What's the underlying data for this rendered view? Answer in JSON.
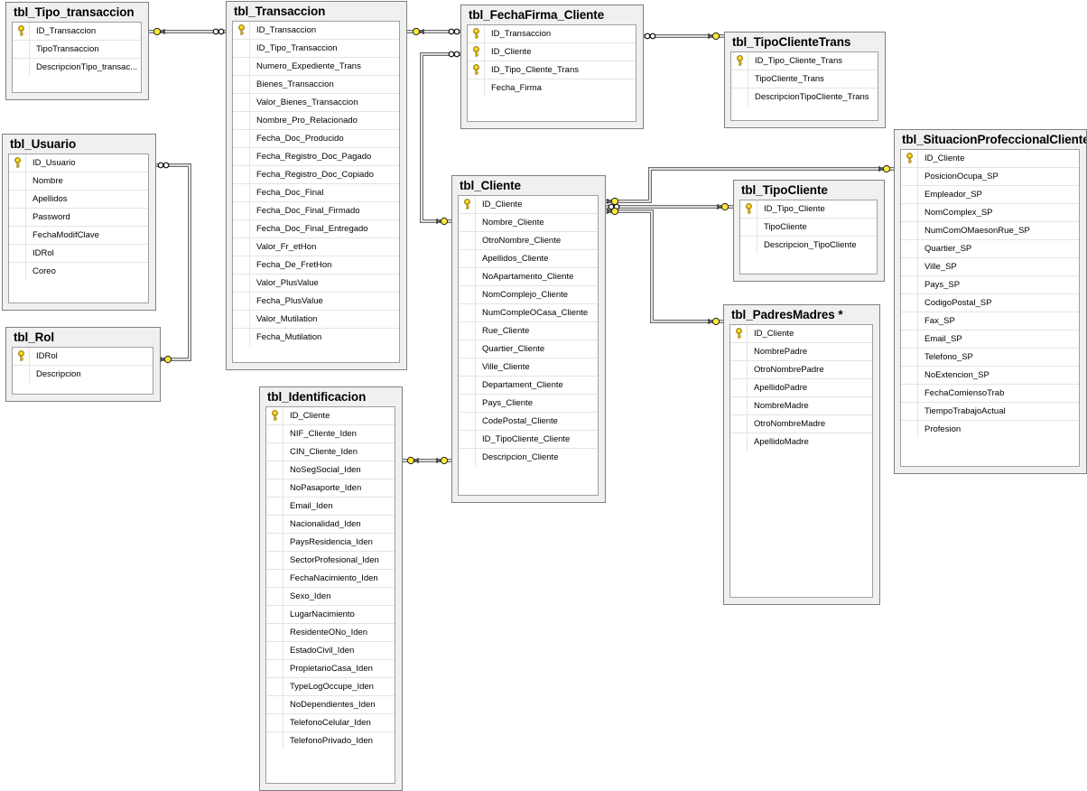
{
  "tables": [
    {
      "id": "tipo_transaccion",
      "title": "tbl_Tipo_transaccion",
      "columns": [
        {
          "name": "ID_Transaccion",
          "pk": true
        },
        {
          "name": "TipoTransaccion",
          "pk": false
        },
        {
          "name": "DescripcionTipo_transac...",
          "pk": false
        }
      ]
    },
    {
      "id": "usuario",
      "title": "tbl_Usuario",
      "columns": [
        {
          "name": "ID_Usuario",
          "pk": true
        },
        {
          "name": "Nombre",
          "pk": false
        },
        {
          "name": "Apellidos",
          "pk": false
        },
        {
          "name": "Password",
          "pk": false
        },
        {
          "name": "FechaModifClave",
          "pk": false
        },
        {
          "name": "IDRol",
          "pk": false
        },
        {
          "name": "Coreo",
          "pk": false
        }
      ]
    },
    {
      "id": "rol",
      "title": "tbl_Rol",
      "columns": [
        {
          "name": "IDRol",
          "pk": true
        },
        {
          "name": "Descripcion",
          "pk": false
        }
      ]
    },
    {
      "id": "transaccion",
      "title": "tbl_Transaccion",
      "columns": [
        {
          "name": "ID_Transaccion",
          "pk": true
        },
        {
          "name": "ID_Tipo_Transaccion",
          "pk": false
        },
        {
          "name": "Numero_Expediente_Trans",
          "pk": false
        },
        {
          "name": "Bienes_Transaccion",
          "pk": false
        },
        {
          "name": "Valor_Bienes_Transaccion",
          "pk": false
        },
        {
          "name": "Nombre_Pro_Relacionado",
          "pk": false
        },
        {
          "name": "Fecha_Doc_Producido",
          "pk": false
        },
        {
          "name": "Fecha_Registro_Doc_Pagado",
          "pk": false
        },
        {
          "name": "Fecha_Registro_Doc_Copiado",
          "pk": false
        },
        {
          "name": "Fecha_Doc_Final",
          "pk": false
        },
        {
          "name": "Fecha_Doc_Final_Firmado",
          "pk": false
        },
        {
          "name": "Fecha_Doc_Final_Entregado",
          "pk": false
        },
        {
          "name": "Valor_Fr_etHon",
          "pk": false
        },
        {
          "name": "Fecha_De_FretHon",
          "pk": false
        },
        {
          "name": "Valor_PlusValue",
          "pk": false
        },
        {
          "name": "Fecha_PlusValue",
          "pk": false
        },
        {
          "name": "Valor_Mutilation",
          "pk": false
        },
        {
          "name": "Fecha_Mutilation",
          "pk": false
        }
      ]
    },
    {
      "id": "identificacion",
      "title": "tbl_Identificacion",
      "columns": [
        {
          "name": "ID_Cliente",
          "pk": true
        },
        {
          "name": "NIF_Cliente_Iden",
          "pk": false
        },
        {
          "name": "CIN_Cliente_Iden",
          "pk": false
        },
        {
          "name": "NoSegSocial_Iden",
          "pk": false
        },
        {
          "name": "NoPasaporte_Iden",
          "pk": false
        },
        {
          "name": "Email_Iden",
          "pk": false
        },
        {
          "name": "Nacionalidad_Iden",
          "pk": false
        },
        {
          "name": "PaysResidencia_Iden",
          "pk": false
        },
        {
          "name": "SectorProfesional_Iden",
          "pk": false
        },
        {
          "name": "FechaNacimiento_Iden",
          "pk": false
        },
        {
          "name": "Sexo_Iden",
          "pk": false
        },
        {
          "name": "LugarNacimiento",
          "pk": false
        },
        {
          "name": "ResidenteONo_Iden",
          "pk": false
        },
        {
          "name": "EstadoCivil_Iden",
          "pk": false
        },
        {
          "name": "PropietarioCasa_Iden",
          "pk": false
        },
        {
          "name": "TypeLogOccupe_Iden",
          "pk": false
        },
        {
          "name": "NoDependientes_Iden",
          "pk": false
        },
        {
          "name": "TelefonoCelular_Iden",
          "pk": false
        },
        {
          "name": "TelefonoPrivado_Iden",
          "pk": false
        }
      ]
    },
    {
      "id": "fechafirma",
      "title": "tbl_FechaFirma_Cliente",
      "columns": [
        {
          "name": "ID_Transaccion",
          "pk": true
        },
        {
          "name": "ID_Cliente",
          "pk": true
        },
        {
          "name": "ID_Tipo_Cliente_Trans",
          "pk": true
        },
        {
          "name": "Fecha_Firma",
          "pk": false
        }
      ]
    },
    {
      "id": "cliente",
      "title": "tbl_Cliente",
      "columns": [
        {
          "name": "ID_Cliente",
          "pk": true
        },
        {
          "name": "Nombre_Cliente",
          "pk": false
        },
        {
          "name": "OtroNombre_Cliente",
          "pk": false
        },
        {
          "name": "Apellidos_Cliente",
          "pk": false
        },
        {
          "name": "NoApartamento_Cliente",
          "pk": false
        },
        {
          "name": "NomComplejo_Cliente",
          "pk": false
        },
        {
          "name": "NumCompleOCasa_Cliente",
          "pk": false
        },
        {
          "name": "Rue_Cliente",
          "pk": false
        },
        {
          "name": "Quartier_Cliente",
          "pk": false
        },
        {
          "name": "Ville_Cliente",
          "pk": false
        },
        {
          "name": "Departament_Cliente",
          "pk": false
        },
        {
          "name": "Pays_Cliente",
          "pk": false
        },
        {
          "name": "CodePostal_Cliente",
          "pk": false
        },
        {
          "name": "ID_TipoCliente_Cliente",
          "pk": false
        },
        {
          "name": "Descripcion_Cliente",
          "pk": false
        }
      ]
    },
    {
      "id": "tipoclientetrans",
      "title": "tbl_TipoClienteTrans",
      "columns": [
        {
          "name": "ID_Tipo_Cliente_Trans",
          "pk": true
        },
        {
          "name": "TipoCliente_Trans",
          "pk": false
        },
        {
          "name": "DescripcionTipoCliente_Trans",
          "pk": false
        }
      ]
    },
    {
      "id": "tipocliente",
      "title": "tbl_TipoCliente",
      "columns": [
        {
          "name": "ID_Tipo_Cliente",
          "pk": true
        },
        {
          "name": "TipoCliente",
          "pk": false
        },
        {
          "name": "Descripcion_TipoCliente",
          "pk": false
        }
      ]
    },
    {
      "id": "padresmadres",
      "title": "tbl_PadresMadres *",
      "columns": [
        {
          "name": "ID_Cliente",
          "pk": true
        },
        {
          "name": "NombrePadre",
          "pk": false
        },
        {
          "name": "OtroNombrePadre",
          "pk": false
        },
        {
          "name": "ApellidoPadre",
          "pk": false
        },
        {
          "name": "NombreMadre",
          "pk": false
        },
        {
          "name": "OtroNombreMadre",
          "pk": false
        },
        {
          "name": "ApellidoMadre",
          "pk": false
        }
      ]
    },
    {
      "id": "situacion",
      "title": "tbl_SituacionProfeccionalCliente",
      "columns": [
        {
          "name": "ID_Cliente",
          "pk": true
        },
        {
          "name": "PosicionOcupa_SP",
          "pk": false
        },
        {
          "name": "Empleador_SP",
          "pk": false
        },
        {
          "name": "NomComplex_SP",
          "pk": false
        },
        {
          "name": "NumComOMaesonRue_SP",
          "pk": false
        },
        {
          "name": "Quartier_SP",
          "pk": false
        },
        {
          "name": "Ville_SP",
          "pk": false
        },
        {
          "name": "Pays_SP",
          "pk": false
        },
        {
          "name": "CodigoPostal_SP",
          "pk": false
        },
        {
          "name": "Fax_SP",
          "pk": false
        },
        {
          "name": "Email_SP",
          "pk": false
        },
        {
          "name": "Telefono_SP",
          "pk": false
        },
        {
          "name": "NoExtencion_SP",
          "pk": false
        },
        {
          "name": "FechaComiensoTrab",
          "pk": false
        },
        {
          "name": "TiempoTrabajoActual",
          "pk": false
        },
        {
          "name": "Profesion",
          "pk": false
        }
      ]
    }
  ]
}
